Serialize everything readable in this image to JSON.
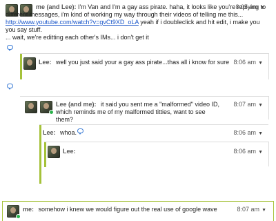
{
  "blips": [
    {
      "author": "me (and Lee):",
      "text_a": "I'm Van and I'm a gay ass pirate.  haha, it looks like you're replying to different messages, i'm kind of working my way through their videos of telling me this...",
      "link": "http://www.youtube.com/watch?v=gvCt9XD_oLA",
      "text_b": "yeah if i doubleclick and hit edit, i make you you say stuff.",
      "text_c": "... wait, we're editting each other's IMs... i don't get it",
      "time": "8:05 am"
    },
    {
      "author": "Lee:",
      "text": "well you just said your a gay ass pirate...thas all i know for sure",
      "time": "8:06 am"
    },
    {
      "author": "Lee (and me):",
      "text": "it said you sent me a \"malformed\" video ID, which reminds me of my malformed titties, want to see them?",
      "time": "8:07 am"
    },
    {
      "author": "Lee:",
      "text": "whoa.",
      "time": "8:06 am"
    },
    {
      "author": "Lee:",
      "text": "",
      "time": "8:06 am"
    },
    {
      "author": "me:",
      "text": "somehow i knew we would figure out the real use of google wave",
      "time": "8:07 am"
    }
  ],
  "menu_caret": "▼",
  "icons": {
    "reply": "reply-bubble-icon",
    "online": "online-dot-icon",
    "menu": "chevron-down-icon",
    "avatar": "user-avatar"
  },
  "colors": {
    "link": "#1a56c9",
    "thread_bar": "#a5c23a",
    "online": "#2bb24c",
    "reply_icon": "#3a7bd5"
  }
}
